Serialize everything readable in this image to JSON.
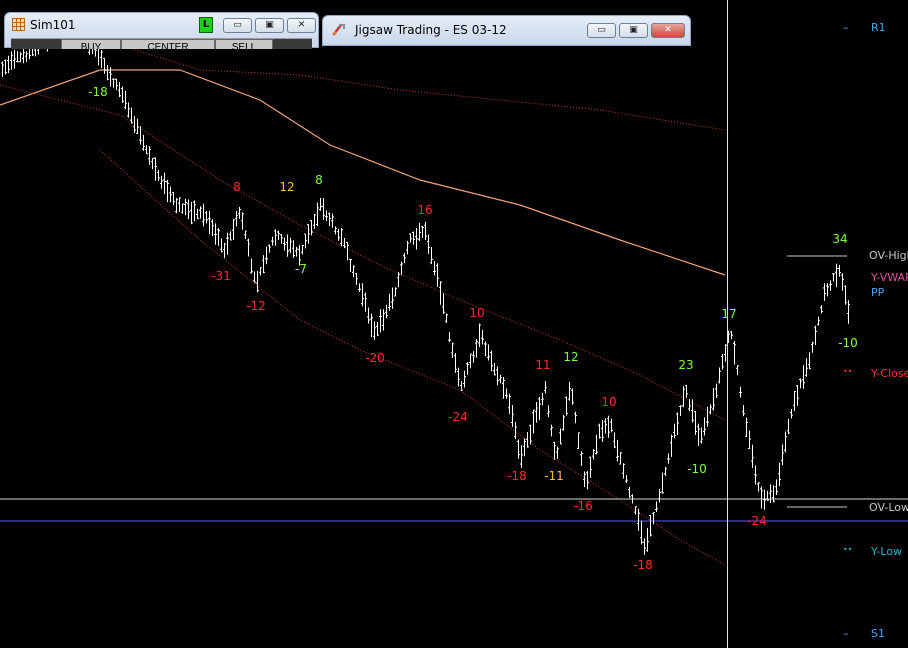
{
  "windows": {
    "sim": {
      "title": "Sim101",
      "status_letter": "L",
      "buttons": [
        "BUY",
        "CENTER",
        "SELL"
      ]
    },
    "jigsaw": {
      "title": "Jigsaw Trading - ES 03-12"
    },
    "controls": {
      "minimize": "▭",
      "maximize": "▣",
      "close": "✕"
    }
  },
  "colors": {
    "background": "#000000",
    "bars": "#ffffff",
    "positive_label": "#7fff3a",
    "negative_label": "#ff2a2a",
    "warning_label": "#ffbf2a",
    "resistance": "#3aa7ff",
    "y_vwap": "#e14fa1",
    "y_close": "#ff3030",
    "y_low": "#2eb3c8",
    "ov_label": "#c8c8c8",
    "ma_orange": "#f0a37a",
    "ma_red": "#c83a2a",
    "ov_low_line": "#5a5aff"
  },
  "levels": [
    {
      "label": "R1",
      "color": "#3aa7ff",
      "marker": "–"
    },
    {
      "label": "OV-High",
      "color": "#c8c8c8",
      "marker": ""
    },
    {
      "label": "Y-VWAP",
      "color": "#e14fa1",
      "marker": ""
    },
    {
      "label": "PP",
      "color": "#3aa7ff",
      "marker": ""
    },
    {
      "label": "Y-Close",
      "color": "#ff3030",
      "marker": "••"
    },
    {
      "label": "OV-Low",
      "color": "#c8c8c8",
      "marker": ""
    },
    {
      "label": "Y-Low",
      "color": "#2eb3c8",
      "marker": "••"
    },
    {
      "label": "S1",
      "color": "#3aa7ff",
      "marker": "–"
    }
  ],
  "chart_data": {
    "type": "ohlc",
    "swing_labels": [
      {
        "text": "-18",
        "color": "#7fff3a"
      },
      {
        "text": "8",
        "color": "#ff2a2a"
      },
      {
        "text": "12",
        "color": "#ffbf2a"
      },
      {
        "text": "8",
        "color": "#7fff3a"
      },
      {
        "text": "-31",
        "color": "#ff2a2a"
      },
      {
        "text": "-7",
        "color": "#7fff3a"
      },
      {
        "text": "-12",
        "color": "#ff2a2a"
      },
      {
        "text": "16",
        "color": "#ff2a2a"
      },
      {
        "text": "-20",
        "color": "#ff2a2a"
      },
      {
        "text": "10",
        "color": "#ff2a2a"
      },
      {
        "text": "11",
        "color": "#ff2a2a"
      },
      {
        "text": "12",
        "color": "#7fff3a"
      },
      {
        "text": "-24",
        "color": "#ff2a2a"
      },
      {
        "text": "10",
        "color": "#ff2a2a"
      },
      {
        "text": "-18",
        "color": "#ff2a2a"
      },
      {
        "text": "-11",
        "color": "#ffbf2a"
      },
      {
        "text": "-16",
        "color": "#ff2a2a"
      },
      {
        "text": "23",
        "color": "#7fff3a"
      },
      {
        "text": "17",
        "color": "#7fff3a"
      },
      {
        "text": "-10",
        "color": "#7fff3a"
      },
      {
        "text": "-18",
        "color": "#ff2a2a"
      },
      {
        "text": "-24",
        "color": "#ff2a2a"
      },
      {
        "text": "34",
        "color": "#7fff3a"
      },
      {
        "text": "-10",
        "color": "#7fff3a"
      }
    ]
  }
}
